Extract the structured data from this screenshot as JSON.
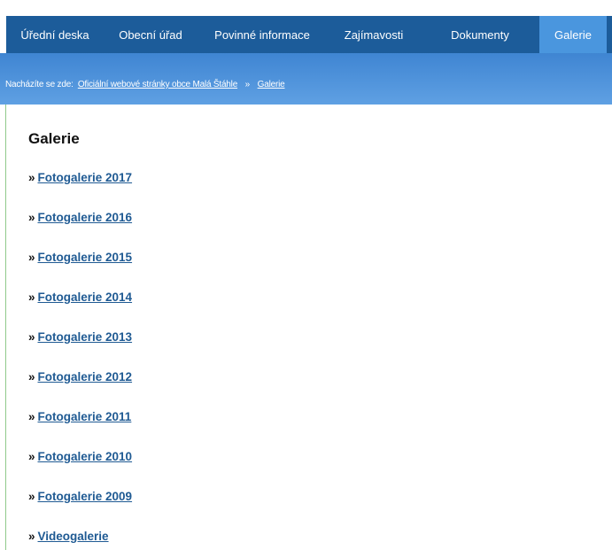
{
  "nav": {
    "items": [
      {
        "label": "Úřední deska"
      },
      {
        "label": "Obecní úřad"
      },
      {
        "label": "Povinné informace"
      },
      {
        "label": "Zajímavosti"
      },
      {
        "label": "Dokumenty"
      },
      {
        "label": "Galerie",
        "active": true
      }
    ]
  },
  "breadcrumb": {
    "prefix": "Nacházíte se zde:",
    "home": "Oficiální webové stránky obce Malá Štáhle",
    "separator": "»",
    "current": "Galerie"
  },
  "page": {
    "title": "Galerie",
    "bullet": "»",
    "links": [
      "Fotogalerie 2017",
      "Fotogalerie 2016",
      "Fotogalerie 2015",
      "Fotogalerie 2014",
      "Fotogalerie 2013",
      "Fotogalerie 2012",
      "Fotogalerie 2011",
      "Fotogalerie 2010",
      "Fotogalerie 2009",
      "Videogalerie"
    ]
  },
  "colors": {
    "nav_bg": "#1c5c9a",
    "nav_active": "#4a96de",
    "breadcrumb_bg": "#4a8fd9",
    "link": "#1f5a93"
  }
}
